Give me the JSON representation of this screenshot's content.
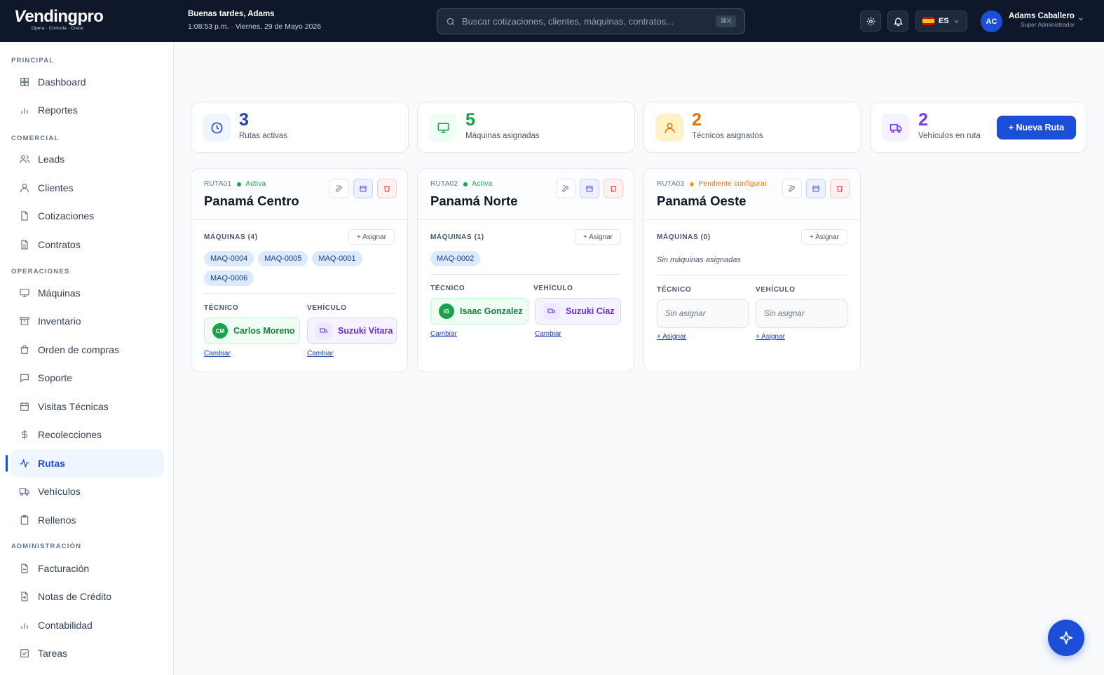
{
  "app": {
    "logo_text": "endingpro",
    "logo_tagline": "Opera · Controla · Crece"
  },
  "header": {
    "greeting": "Buenas tardes, Adams",
    "datetime": "1:08:53 p.m. · Viernes, 29 de Mayo 2026",
    "search_placeholder": "Buscar cotizaciones, clientes, máquinas, contratos...",
    "search_shortcut": "⌘K",
    "language": "ES",
    "user": {
      "initials": "AC",
      "name": "Adams Caballero",
      "role": "Super Administrador"
    }
  },
  "sidebar": {
    "sections": [
      {
        "title": "PRINCIPAL",
        "items": [
          {
            "label": "Dashboard",
            "icon": "grid-icon"
          },
          {
            "label": "Reportes",
            "icon": "bar-chart-icon"
          }
        ]
      },
      {
        "title": "COMERCIAL",
        "items": [
          {
            "label": "Leads",
            "icon": "users-icon"
          },
          {
            "label": "Clientes",
            "icon": "user-icon"
          },
          {
            "label": "Cotizaciones",
            "icon": "file-icon"
          },
          {
            "label": "Contratos",
            "icon": "file-text-icon"
          }
        ]
      },
      {
        "title": "OPERACIONES",
        "items": [
          {
            "label": "Máquinas",
            "icon": "monitor-icon"
          },
          {
            "label": "Inventario",
            "icon": "archive-icon"
          },
          {
            "label": "Orden de compras",
            "icon": "shopping-bag-icon"
          },
          {
            "label": "Soporte",
            "icon": "message-icon"
          },
          {
            "label": "Visitas Técnicas",
            "icon": "calendar-icon"
          },
          {
            "label": "Recolecciones",
            "icon": "dollar-icon"
          },
          {
            "label": "Rutas",
            "icon": "activity-icon",
            "active": true
          },
          {
            "label": "Vehículos",
            "icon": "truck-icon"
          },
          {
            "label": "Rellenos",
            "icon": "clipboard-icon"
          }
        ]
      },
      {
        "title": "ADMINISTRACIÓN",
        "items": [
          {
            "label": "Facturación",
            "icon": "invoice-icon"
          },
          {
            "label": "Notas de Crédito",
            "icon": "credit-note-icon"
          },
          {
            "label": "Contabilidad",
            "icon": "bar-chart-icon"
          },
          {
            "label": "Tareas",
            "icon": "check-square-icon"
          }
        ]
      }
    ]
  },
  "stats": [
    {
      "value": "3",
      "label": "Rutas activas",
      "color": "#1e40af"
    },
    {
      "value": "5",
      "label": "Máquinas asignadas",
      "color": "#16a34a"
    },
    {
      "value": "2",
      "label": "Técnicos asignados",
      "color": "#d97706"
    },
    {
      "value": "2",
      "label": "Vehículos en ruta",
      "color": "#7c3aed"
    }
  ],
  "new_route_label": "+ Nueva Ruta",
  "routes": [
    {
      "code": "RUTA01",
      "status": "Activa",
      "status_color": "#16a34a",
      "name": "Panamá Centro",
      "machines_title": "MÁQUINAS (4)",
      "assign_label": "+ Asignar",
      "machines": [
        "MAQ-0004",
        "MAQ-0005",
        "MAQ-0001",
        "MAQ-0006"
      ],
      "tech_title": "TÉCNICO",
      "vehicle_title": "VEHÍCULO",
      "tech_initials": "CM",
      "tech_name": "Carlos Moreno",
      "vehicle_name": "Suzuki Vitara",
      "tech_link": "Cambiar",
      "vehicle_link": "Cambiar"
    },
    {
      "code": "RUTA02",
      "status": "Activa",
      "status_color": "#16a34a",
      "name": "Panamá Norte",
      "machines_title": "MÁQUINAS (1)",
      "assign_label": "+ Asignar",
      "machines": [
        "MAQ-0002"
      ],
      "tech_title": "TÉCNICO",
      "vehicle_title": "VEHÍCULO",
      "tech_initials": "IG",
      "tech_name": "Isaac Gonzalez",
      "vehicle_name": "Suzuki Ciaz",
      "tech_link": "Cambiar",
      "vehicle_link": "Cambiar"
    },
    {
      "code": "RUTA03",
      "status": "Pendiente configurar",
      "status_color": "#d97706",
      "name": "Panamá Oeste",
      "machines_title": "MÁQUINAS (0)",
      "assign_label": "+ Asignar",
      "machines_empty": "Sin máquinas asignadas",
      "tech_title": "TÉCNICO",
      "vehicle_title": "VEHÍCULO",
      "tech_empty": "Sin asignar",
      "vehicle_empty": "Sin asignar",
      "tech_link": "+ Asignar",
      "vehicle_link": "+ Asignar"
    }
  ]
}
